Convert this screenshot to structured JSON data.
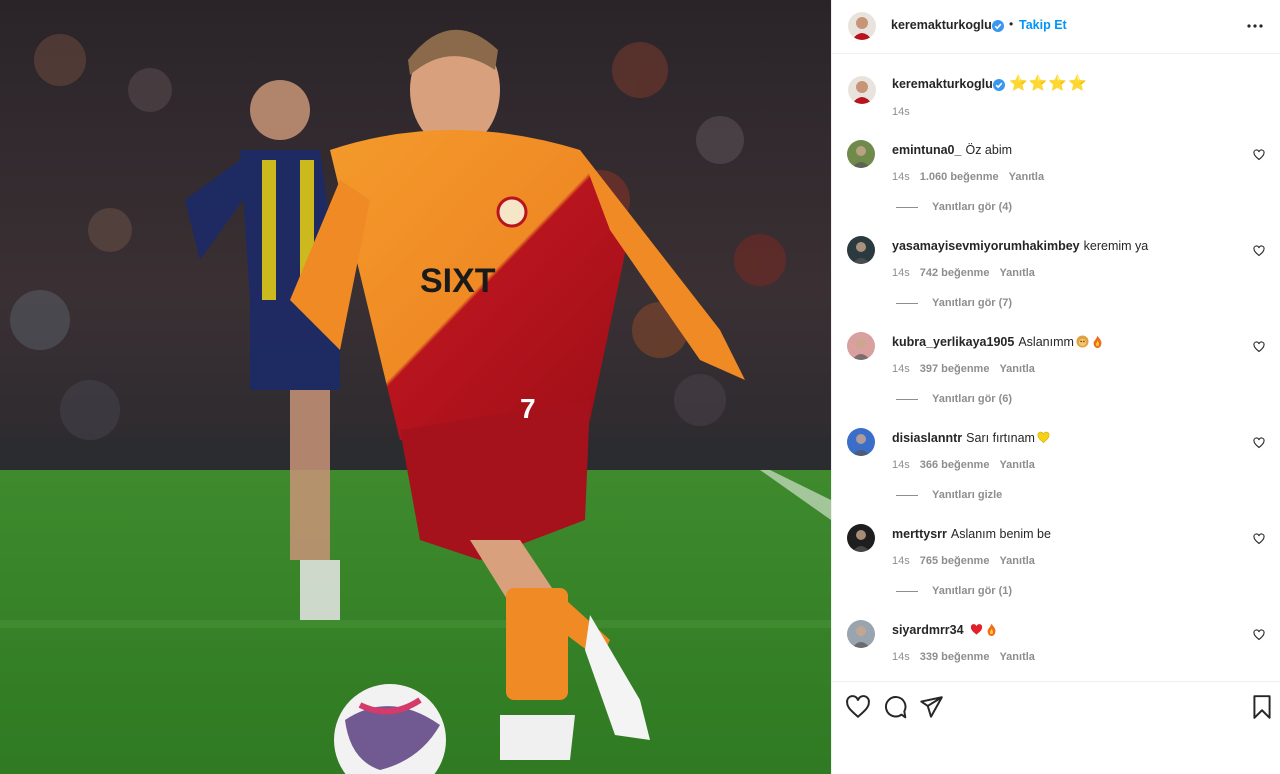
{
  "post": {
    "author": "keremakturkoglu",
    "follow_label": "Takip Et",
    "separator": "•",
    "caption_stars": "⭐⭐⭐⭐",
    "caption_time": "14s"
  },
  "comments": [
    {
      "user": "emintuna0_",
      "text": "Öz abim",
      "time": "14s",
      "likes": "1.060 beğenme",
      "reply": "Yanıtla",
      "replies": "Yanıtları gör (4)",
      "emoji": []
    },
    {
      "user": "yasamayisevmiyorumhakimbey",
      "text": "keremim ya",
      "time": "14s",
      "likes": "742 beğenme",
      "reply": "Yanıtla",
      "replies": "Yanıtları gör (7)",
      "emoji": []
    },
    {
      "user": "kubra_yerlikaya1905",
      "text": "Aslanımm",
      "time": "14s",
      "likes": "397 beğenme",
      "reply": "Yanıtla",
      "replies": "Yanıtları gör (6)",
      "emoji": [
        "lion-emoji",
        "fire-emoji"
      ]
    },
    {
      "user": "disiaslanntr",
      "text": "Sarı fırtınam",
      "time": "14s",
      "likes": "366 beğenme",
      "reply": "Yanıtla",
      "replies": "Yanıtları gizle",
      "emoji": [
        "yellow-heart-emoji"
      ]
    },
    {
      "user": "merttysrr",
      "text": "Aslanım benim be",
      "time": "14s",
      "likes": "765 beğenme",
      "reply": "Yanıtla",
      "replies": "Yanıtları gör (1)",
      "emoji": []
    },
    {
      "user": "siyardmrr34",
      "text": "",
      "time": "14s",
      "likes": "339 beğenme",
      "reply": "Yanıtla",
      "replies": "",
      "emoji": [
        "red-heart-emoji",
        "fire-emoji"
      ]
    }
  ],
  "actions": [
    "heart-icon",
    "comment-icon",
    "share-icon",
    "bookmark-icon"
  ],
  "colors": {
    "accent": "#0095f6",
    "verified": "#3897f0",
    "muted": "#8e8e8e",
    "jersey_orange": "#f08a24",
    "jersey_red": "#b8141e"
  }
}
